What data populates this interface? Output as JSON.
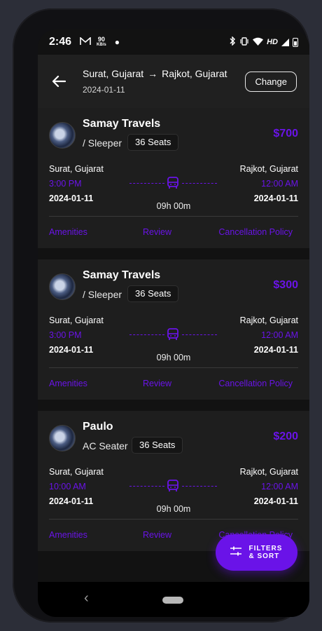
{
  "status_bar": {
    "time": "2:46",
    "speed_value": "90",
    "speed_unit": "KB/s",
    "network": "HD"
  },
  "header": {
    "from": "Surat, Gujarat",
    "arrow": "→",
    "to": "Rajkot, Gujarat",
    "date": "2024-01-11",
    "change_label": "Change"
  },
  "buses": [
    {
      "operator": "Samay Travels",
      "bus_type": "/ Sleeper",
      "seats": "36 Seats",
      "price": "$700",
      "from_city": "Surat, Gujarat",
      "to_city": "Rajkot, Gujarat",
      "departure_time": "3:00 PM",
      "arrival_time": "12:00 AM",
      "departure_date": "2024-01-11",
      "arrival_date": "2024-01-11",
      "duration": "09h 00m",
      "links": {
        "amenities": "Amenities",
        "review": "Review",
        "cancellation": "Cancellation Policy"
      }
    },
    {
      "operator": "Samay Travels",
      "bus_type": "/ Sleeper",
      "seats": "36 Seats",
      "price": "$300",
      "from_city": "Surat, Gujarat",
      "to_city": "Rajkot, Gujarat",
      "departure_time": "3:00 PM",
      "arrival_time": "12:00 AM",
      "departure_date": "2024-01-11",
      "arrival_date": "2024-01-11",
      "duration": "09h 00m",
      "links": {
        "amenities": "Amenities",
        "review": "Review",
        "cancellation": "Cancellation Policy"
      }
    },
    {
      "operator": "Paulo",
      "bus_type": "AC Seater",
      "seats": "36 Seats",
      "price": "$200",
      "from_city": "Surat, Gujarat",
      "to_city": "Rajkot, Gujarat",
      "departure_time": "10:00 AM",
      "arrival_time": "12:00 AM",
      "departure_date": "2024-01-11",
      "arrival_date": "2024-01-11",
      "duration": "09h 00m",
      "links": {
        "amenities": "Amenities",
        "review": "Review",
        "cancellation": "Cancellation Policy"
      }
    }
  ],
  "fab": {
    "label": "FILTERS & SORT"
  },
  "colors": {
    "accent": "#6a13e8",
    "card": "#1e1e1e",
    "background": "#121212"
  },
  "icons": [
    "gmail-icon",
    "bluetooth-icon",
    "vibrate-icon",
    "wifi-icon",
    "signal-icon",
    "battery-icon",
    "back-arrow-icon",
    "bus-icon",
    "filter-sliders-icon"
  ]
}
